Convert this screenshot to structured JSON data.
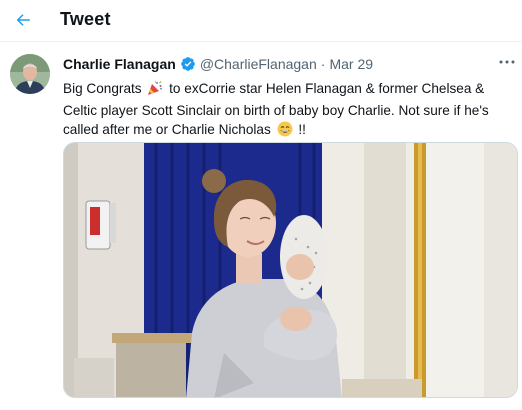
{
  "header": {
    "title": "Tweet",
    "back_icon": "back-arrow-icon"
  },
  "tweet": {
    "author_name": "Charlie Flanagan",
    "handle": "@CharlieFlanagan",
    "separator": "·",
    "date": "Mar 29",
    "verified_icon": "verified-badge-icon",
    "more_icon": "more-options-icon",
    "text_part1": "Big Congrats",
    "emoji_party": "party-popper-icon",
    "text_part2": "to exCorrie star Helen Flanagan & former Chelsea & Celtic player Scott Sinclair on birth of baby boy Charlie. Not sure if he's called after me or Charlie Nicholas",
    "emoji_grin": "grinning-face-icon",
    "text_part3": "!!",
    "media_description_icon": "photo"
  },
  "colors": {
    "accent": "#1d9bf0",
    "text": "#0f1419",
    "secondary": "#536471",
    "border": "#cfd9de"
  }
}
